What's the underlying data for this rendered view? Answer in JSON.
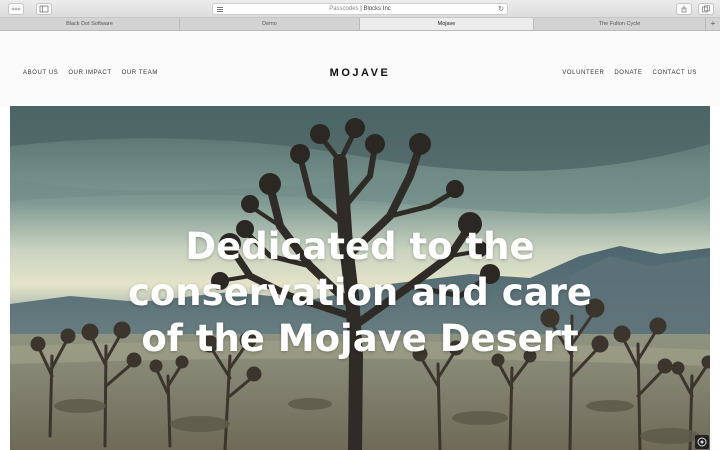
{
  "browser": {
    "url_prefix": "Passcodes",
    "url_domain": "Blocks Inc",
    "tabs": [
      {
        "label": "Black Dot Software",
        "active": false
      },
      {
        "label": "Demo",
        "active": false
      },
      {
        "label": "Mojave",
        "active": true
      },
      {
        "label": "The Fulton Cycle",
        "active": false
      }
    ],
    "new_tab_label": "+"
  },
  "site": {
    "logo": "MOJAVE",
    "nav_left": [
      "ABOUT US",
      "OUR IMPACT",
      "OUR TEAM"
    ],
    "nav_right": [
      "VOLUNTEER",
      "DONATE",
      "CONTACT US"
    ]
  },
  "hero": {
    "heading_lines": [
      "Dedicated to the",
      "conservation and care",
      "of the Mojave Desert"
    ],
    "image_subject": "joshua-tree-desert-landscape"
  },
  "colors": {
    "sky_top": "#4f6a6a",
    "sky_mid": "#9fb7ae",
    "horizon_glow": "#dfe3c9",
    "mountains": "#506a73",
    "desert_ground": "#8e8a72",
    "tree_dark": "#2f2b27"
  }
}
